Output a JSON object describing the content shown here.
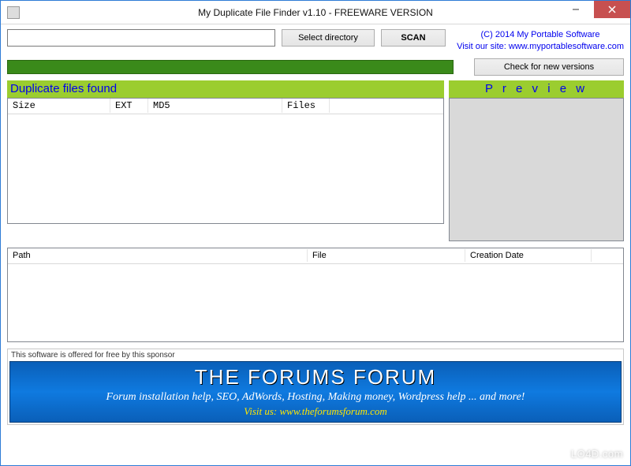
{
  "window": {
    "title": "My Duplicate File Finder v1.10 - FREEWARE VERSION"
  },
  "toolbar": {
    "directory_value": "",
    "select_dir_label": "Select directory",
    "scan_label": "SCAN"
  },
  "info": {
    "copyright": "(C) 2014 My Portable Software",
    "visit_prefix": "Visit our site: ",
    "visit_url": "www.myportablesoftware.com",
    "check_versions_label": "Check for new versions"
  },
  "panels": {
    "duplicates_header": "Duplicate files found",
    "preview_header": "P r e v i e w"
  },
  "dup_table": {
    "cols": {
      "size": "Size",
      "ext": "EXT",
      "md5": "MD5",
      "files": "Files"
    },
    "rows": []
  },
  "path_table": {
    "cols": {
      "path": "Path",
      "file": "File",
      "date": "Creation Date"
    },
    "rows": []
  },
  "sponsor": {
    "label": "This software is offered for free by this sponsor",
    "banner_title": "THE FORUMS FORUM",
    "banner_sub": "Forum installation help, SEO, AdWords, Hosting, Making money, Wordpress help ... and more!",
    "banner_visit_prefix": "Visit us: ",
    "banner_visit_url": "www.theforumsforum.com"
  },
  "watermark": "LO4D.com"
}
